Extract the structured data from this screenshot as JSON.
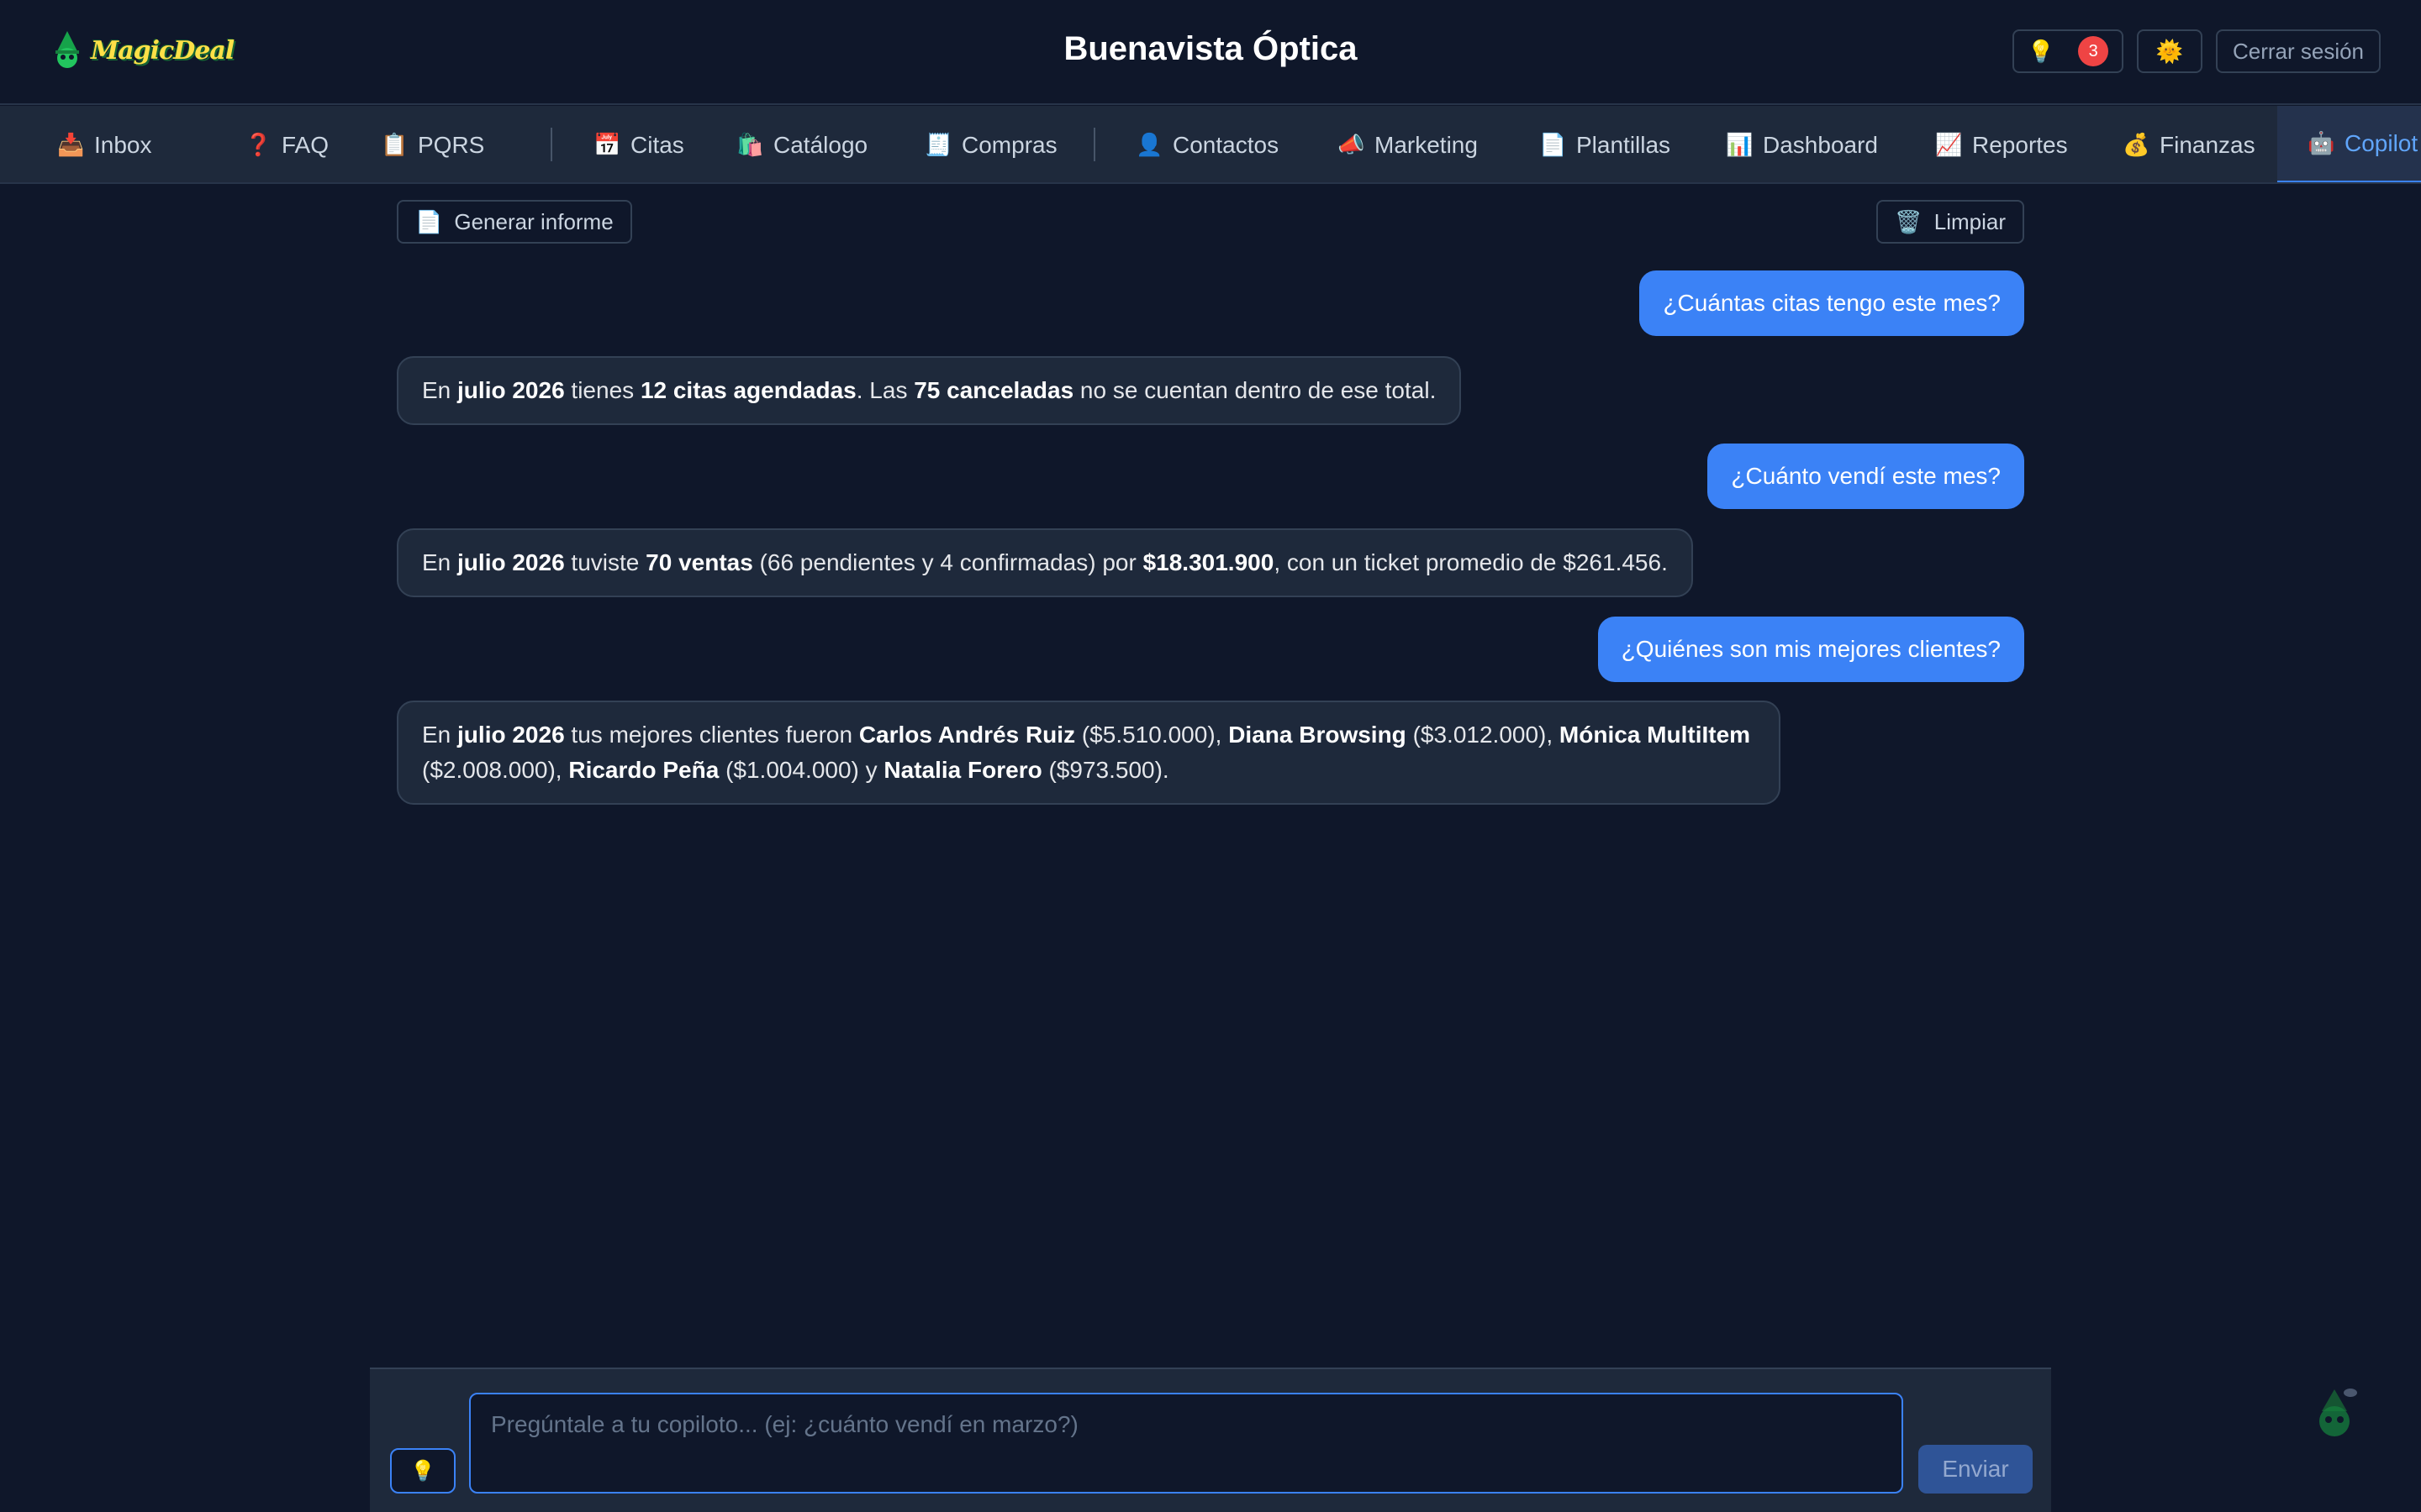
{
  "header": {
    "logo_text": "MagicDeal",
    "title": "Buenavista Óptica",
    "ideas_icon": "lightbulb-icon",
    "ideas_count": "3",
    "theme_icon": "sun-icon",
    "logout_label": "Cerrar sesión"
  },
  "nav": {
    "items": [
      {
        "icon": "📥",
        "label": "Inbox"
      },
      {
        "icon": "❓",
        "label": "FAQ"
      },
      {
        "icon": "📋",
        "label": "PQRS"
      },
      {
        "icon": "📅",
        "label": "Citas"
      },
      {
        "icon": "🛍️",
        "label": "Catálogo"
      },
      {
        "icon": "🧾",
        "label": "Compras"
      },
      {
        "icon": "👤",
        "label": "Contactos"
      },
      {
        "icon": "📣",
        "label": "Marketing"
      },
      {
        "icon": "📄",
        "label": "Plantillas"
      },
      {
        "icon": "📊",
        "label": "Dashboard"
      },
      {
        "icon": "📈",
        "label": "Reportes"
      },
      {
        "icon": "💰",
        "label": "Finanzas"
      },
      {
        "icon": "🤖",
        "label": "Copilot"
      }
    ],
    "active": "Copilot"
  },
  "toolbar": {
    "report_icon": "📄",
    "report_label": "Generar informe",
    "clear_icon": "🗑️",
    "clear_label": "Limpiar"
  },
  "messages": [
    {
      "role": "user",
      "text": "¿Cuántas citas tengo este mes?"
    },
    {
      "role": "assistant",
      "parts": [
        {
          "t": "En "
        },
        {
          "t": "julio 2026",
          "b": true
        },
        {
          "t": " tienes "
        },
        {
          "t": "12 citas agendadas",
          "b": true
        },
        {
          "t": ". Las "
        },
        {
          "t": "75 canceladas",
          "b": true
        },
        {
          "t": " no se cuentan dentro de ese total."
        }
      ]
    },
    {
      "role": "user",
      "text": "¿Cuánto vendí este mes?"
    },
    {
      "role": "assistant",
      "parts": [
        {
          "t": "En "
        },
        {
          "t": "julio 2026",
          "b": true
        },
        {
          "t": " tuviste "
        },
        {
          "t": "70 ventas",
          "b": true
        },
        {
          "t": " (66 pendientes y 4 confirmadas) por "
        },
        {
          "t": "$18.301.900",
          "b": true
        },
        {
          "t": ", con un ticket promedio de $261.456."
        }
      ]
    },
    {
      "role": "user",
      "text": "¿Quiénes son mis mejores clientes?"
    },
    {
      "role": "assistant",
      "parts": [
        {
          "t": "En "
        },
        {
          "t": "julio 2026",
          "b": true
        },
        {
          "t": " tus mejores clientes fueron "
        },
        {
          "t": "Carlos Andrés Ruiz",
          "b": true
        },
        {
          "t": " ($5.510.000), "
        },
        {
          "t": "Diana Browsing",
          "b": true
        },
        {
          "t": " ($3.012.000), "
        },
        {
          "t": "Mónica MultiItem",
          "b": true
        },
        {
          "t": " ($2.008.000), "
        },
        {
          "t": "Ricardo Peña",
          "b": true
        },
        {
          "t": " ($1.004.000) y "
        },
        {
          "t": "Natalia Forero",
          "b": true
        },
        {
          "t": " ($973.500)."
        }
      ]
    }
  ],
  "composer": {
    "placeholder": "Pregúntale a tu copiloto... (ej: ¿cuánto vendí en marzo?)",
    "value": "",
    "hint_icon": "lightbulb-icon",
    "send_label": "Enviar"
  },
  "colors": {
    "background": "#0f172a",
    "panel": "#1e293b",
    "accent": "#3b82f6",
    "badge": "#ef4444"
  }
}
